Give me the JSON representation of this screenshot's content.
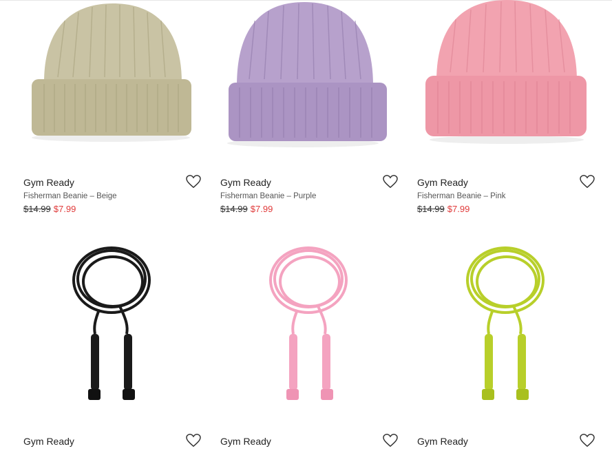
{
  "products": [
    {
      "brand": "Gym Ready",
      "name": "Fisherman Beanie – Beige",
      "price_old": "$14.99",
      "price_sale": "$7.99",
      "color": "#c9c3a4",
      "image": "beanie",
      "wishlist_icon": "heart-outline-icon"
    },
    {
      "brand": "Gym Ready",
      "name": "Fisherman Beanie – Purple",
      "price_old": "$14.99",
      "price_sale": "$7.99",
      "color": "#b7a1cc",
      "image": "beanie",
      "wishlist_icon": "heart-outline-icon"
    },
    {
      "brand": "Gym Ready",
      "name": "Fisherman Beanie – Pink",
      "price_old": "$14.99",
      "price_sale": "$7.99",
      "color": "#f2a3b0",
      "image": "beanie",
      "wishlist_icon": "heart-outline-icon"
    },
    {
      "brand": "Gym Ready",
      "color": "#1a1a1a",
      "image": "jump-rope",
      "wishlist_icon": "heart-outline-icon"
    },
    {
      "brand": "Gym Ready",
      "color": "#f4a3c0",
      "image": "jump-rope",
      "wishlist_icon": "heart-outline-icon"
    },
    {
      "brand": "Gym Ready",
      "color": "#b8cf2a",
      "image": "jump-rope",
      "wishlist_icon": "heart-outline-icon"
    }
  ],
  "colors": {
    "sale": "#e03a3a"
  }
}
